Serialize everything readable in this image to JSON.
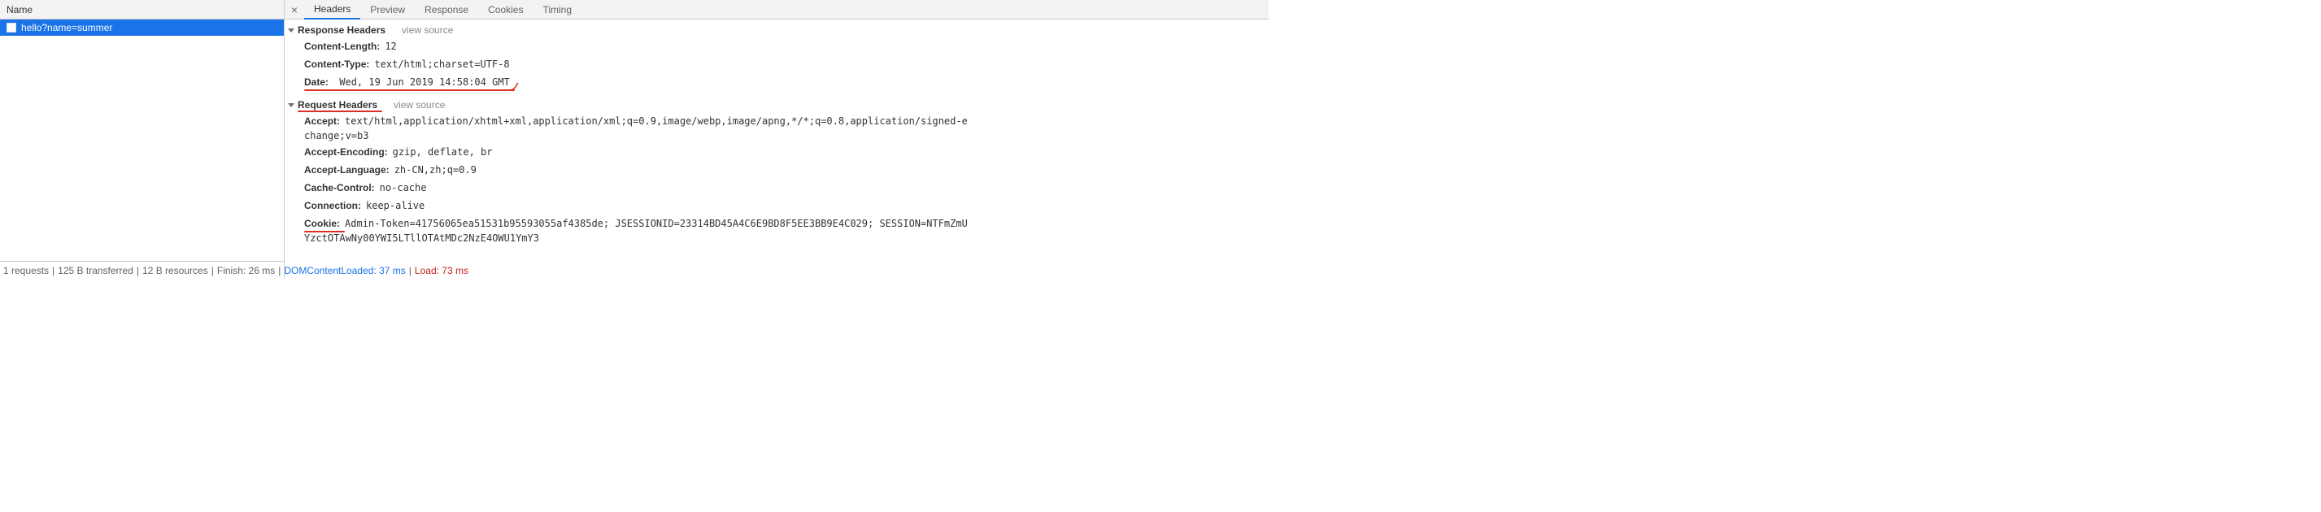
{
  "left": {
    "column_header": "Name",
    "selected_request": "hello?name=summer"
  },
  "status": {
    "requests": "1 requests",
    "transferred": "125 B transferred",
    "resources": "12 B resources",
    "finish_label": "Finish:",
    "finish_value": "26 ms",
    "dcl_label": "DOMContentLoaded:",
    "dcl_value": "37 ms",
    "load_label": "Load:",
    "load_value": "73 ms"
  },
  "tabs": {
    "headers": "Headers",
    "preview": "Preview",
    "response": "Response",
    "cookies": "Cookies",
    "timing": "Timing"
  },
  "response_section": {
    "title": "Response Headers",
    "view_source": "view source",
    "content_length_k": "Content-Length:",
    "content_length_v": "12",
    "content_type_k": "Content-Type:",
    "content_type_v": "text/html;charset=UTF-8",
    "date_k": "Date:",
    "date_v": "Wed, 19 Jun 2019 14:58:04 GMT"
  },
  "request_section": {
    "title": "Request Headers",
    "view_source": "view source",
    "accept_k": "Accept:",
    "accept_v": "text/html,application/xhtml+xml,application/xml;q=0.9,image/webp,image/apng,*/*;q=0.8,application/signed-e",
    "accept_cont": "change;v=b3",
    "accept_encoding_k": "Accept-Encoding:",
    "accept_encoding_v": "gzip, deflate, br",
    "accept_language_k": "Accept-Language:",
    "accept_language_v": "zh-CN,zh;q=0.9",
    "cache_control_k": "Cache-Control:",
    "cache_control_v": "no-cache",
    "connection_k": "Connection:",
    "connection_v": "keep-alive",
    "cookie_k": "Cookie:",
    "cookie_v": "Admin-Token=41756065ea51531b95593055af4385de; JSESSIONID=23314BD45A4C6E9BD8F5EE3BB9E4C029; SESSION=NTFmZmU",
    "cookie_cont": "YzctOTAwNy00YWI5LTllOTAtMDc2NzE4OWU1YmY3"
  }
}
